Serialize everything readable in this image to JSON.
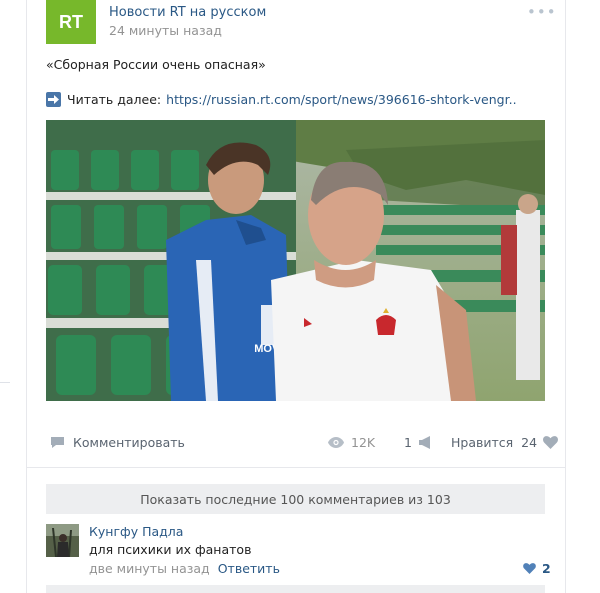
{
  "post": {
    "author": "Новости RT на русском",
    "time": "24 минуты назад",
    "more_icon": "ellipsis-icon",
    "logo_text": "RT",
    "title": "«Сборная России очень опасная»",
    "readmore_label": "Читать далее:",
    "readmore_link": "https://russian.rt.com/sport/news/396616-shtork-vengr..",
    "photo_badge": "MOVIE"
  },
  "actions": {
    "comment_label": "Комментировать",
    "views": "12K",
    "shares": "1",
    "like_label": "Нравится",
    "like_count": "24"
  },
  "comments": {
    "show_more_label": "Показать последние 100 комментариев из 103",
    "items": [
      {
        "author": "Кунгфу Падла",
        "text": "для психики их фанатов",
        "time": "две минуты назад",
        "reply_label": "Ответить",
        "likes": "2"
      }
    ]
  },
  "colors": {
    "accent": "#2a5885",
    "rt_green": "#77b82b",
    "muted": "#939393",
    "background_gray": "#edeef0"
  }
}
